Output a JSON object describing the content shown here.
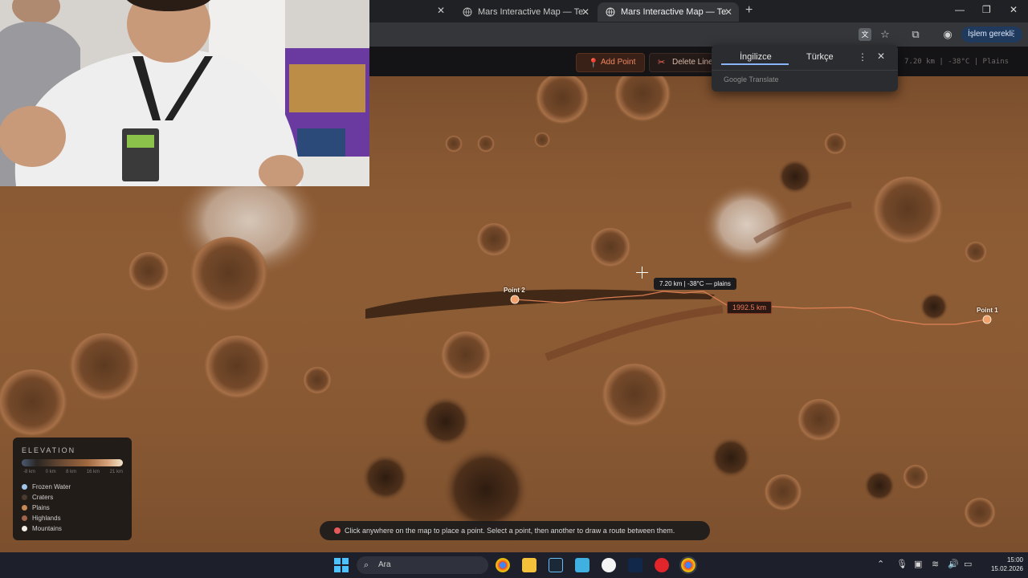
{
  "browser": {
    "tabs": [
      {
        "title": "Mars Interactive Map — Terrain",
        "active": false
      },
      {
        "title": "Mars Interactive Map — Terrain",
        "active": true
      }
    ],
    "action_pill": "İşlem gerekli"
  },
  "toolbar": {
    "add_point_label": "Add Point",
    "delete_line_label": "Delete Line",
    "status_readout": "7.20 km | -38°C | Plains"
  },
  "translate_popup": {
    "tab_source": "İngilizce",
    "tab_target": "Türkçe",
    "footer": "Google Translate"
  },
  "map": {
    "points": [
      {
        "label": "Point 1"
      },
      {
        "label": "Point 2"
      }
    ],
    "hover_tooltip": "7.20 km | -38°C — plains",
    "route_distance": "1992.5 km"
  },
  "legend": {
    "title": "ELEVATION",
    "ticks": [
      "-8 km",
      "0 km",
      "8 km",
      "16 km",
      "21 km"
    ],
    "items": [
      {
        "label": "Frozen Water",
        "color": "#9fc6e8"
      },
      {
        "label": "Craters",
        "color": "#4a3a30"
      },
      {
        "label": "Plains",
        "color": "#c88a55"
      },
      {
        "label": "Highlands",
        "color": "#a0654a"
      },
      {
        "label": "Mountains",
        "color": "#f2eee6"
      }
    ]
  },
  "hint": {
    "text": "Click anywhere on the map to place a point. Select a point, then another to draw a route between them."
  },
  "taskbar": {
    "search_label": "Ara",
    "time": "15:00",
    "date": "15.02.2026"
  },
  "colors": {
    "accent": "#f07a5a",
    "route": "#e8855a",
    "mars_surface": "#8a5a33"
  }
}
